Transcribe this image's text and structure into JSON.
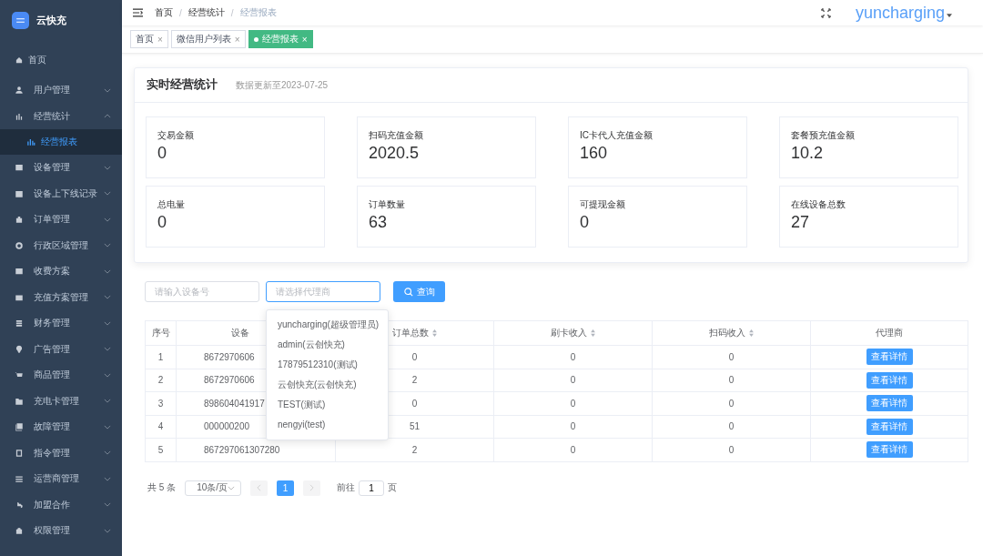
{
  "logo": {
    "name": "云快充"
  },
  "sidebar": {
    "items": [
      {
        "label": "首页",
        "expandable": false
      },
      {
        "label": "用户管理",
        "expandable": true,
        "expanded": false
      },
      {
        "label": "经营统计",
        "expandable": true,
        "expanded": true,
        "children": [
          {
            "label": "经营报表",
            "selected": true
          }
        ]
      },
      {
        "label": "设备管理",
        "expandable": true,
        "expanded": false
      },
      {
        "label": "设备上下线记录",
        "expandable": true,
        "expanded": false
      },
      {
        "label": "订单管理",
        "expandable": true,
        "expanded": false
      },
      {
        "label": "行政区域管理",
        "expandable": true,
        "expanded": false
      },
      {
        "label": "收费方案",
        "expandable": true,
        "expanded": false
      },
      {
        "label": "充值方案管理",
        "expandable": true,
        "expanded": false
      },
      {
        "label": "财务管理",
        "expandable": true,
        "expanded": false
      },
      {
        "label": "广告管理",
        "expandable": true,
        "expanded": false
      },
      {
        "label": "商品管理",
        "expandable": true,
        "expanded": false
      },
      {
        "label": "充电卡管理",
        "expandable": true,
        "expanded": false
      },
      {
        "label": "故障管理",
        "expandable": true,
        "expanded": false
      },
      {
        "label": "指令管理",
        "expandable": true,
        "expanded": false
      },
      {
        "label": "运营商管理",
        "expandable": true,
        "expanded": false
      },
      {
        "label": "加盟合作",
        "expandable": true,
        "expanded": false
      },
      {
        "label": "权限管理",
        "expandable": true,
        "expanded": false
      }
    ]
  },
  "breadcrumb": {
    "separator": "/",
    "items": [
      "首页",
      "经营统计",
      "经营报表"
    ]
  },
  "user": {
    "name": "yuncharging"
  },
  "tags": [
    {
      "label": "首页",
      "selected": false,
      "close": "×"
    },
    {
      "label": "微信用户列表",
      "selected": false,
      "close": "×"
    },
    {
      "label": "经营报表",
      "selected": true,
      "close": "×"
    }
  ],
  "stats_card": {
    "title": "实时经营统计",
    "subtitle": "数据更新至2023-07-25",
    "stats": [
      {
        "label": "交易金额",
        "value": "0"
      },
      {
        "label": "扫码充值金额",
        "value": "2020.5"
      },
      {
        "label": "IC卡代人充值金额",
        "value": "160"
      },
      {
        "label": "套餐预充值金额",
        "value": "10.2"
      },
      {
        "label": "总电量",
        "value": "0"
      },
      {
        "label": "订单数量",
        "value": "63"
      },
      {
        "label": "可提现金额",
        "value": "0"
      },
      {
        "label": "在线设备总数",
        "value": "27"
      }
    ]
  },
  "filters": {
    "device_field": {
      "placeholder": "请输入设备号"
    },
    "agent_select": {
      "placeholder": "请选择代理商",
      "focused": true
    },
    "search_button": "查询"
  },
  "agent_dropdown": [
    "yuncharging(超级管理员)",
    "admin(云创快充)",
    "17879512310(测试)",
    "云创快充(云创快充)",
    "TEST(测试)",
    "nengyi(test)"
  ],
  "table": {
    "columns": [
      {
        "label": "序号",
        "sortable": false
      },
      {
        "label": "设备",
        "sortable": false
      },
      {
        "label": "订单总数",
        "sortable": true
      },
      {
        "label": "刷卡收入",
        "sortable": true
      },
      {
        "label": "扫码收入",
        "sortable": true
      },
      {
        "label": "代理商",
        "sortable": false
      }
    ],
    "rows": [
      {
        "cells": [
          "1",
          "8672970606",
          "0",
          "0",
          "0"
        ],
        "action": "查看详情"
      },
      {
        "cells": [
          "2",
          "8672970606",
          "2",
          "0",
          "0"
        ],
        "action": "查看详情"
      },
      {
        "cells": [
          "3",
          "898604041917",
          "0",
          "0",
          "0"
        ],
        "action": "查看详情"
      },
      {
        "cells": [
          "4",
          "000000200",
          "51",
          "0",
          "0"
        ],
        "action": "查看详情"
      },
      {
        "cells": [
          "5",
          "867297061307280",
          "2",
          "0",
          "0"
        ],
        "action": "查看详情"
      }
    ]
  },
  "pagination": {
    "total": "共 5 条",
    "page_size": "10条/页",
    "pages": [
      {
        "label": "1",
        "selected": true
      }
    ],
    "goto_label": "前往",
    "goto_value": "1",
    "goto_suffix": "页"
  }
}
